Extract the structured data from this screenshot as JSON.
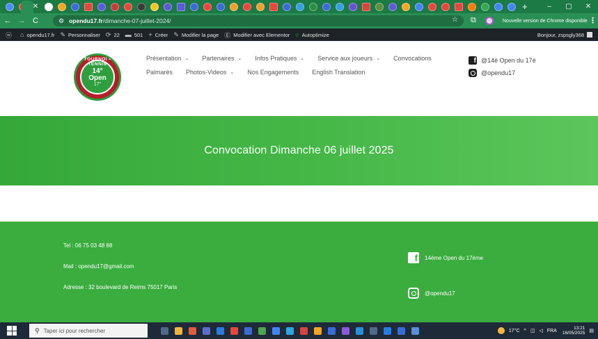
{
  "browser": {
    "tab_icon_colors": [
      "#4d8ef7",
      "#e8453c",
      "#ffffff",
      "#f5a623",
      "#3b6cd6",
      "#e8453c",
      "#5b5bd6",
      "#c93b3b",
      "#e8453c",
      "#3b3b3b",
      "#f5c623",
      "#5b5bd6",
      "#5b5bd6",
      "#3b6cd6",
      "#e8453c",
      "#3b6cd6",
      "#f29e2e",
      "#e8453c",
      "#f29e2e",
      "#e8453c",
      "#3b6cd6",
      "#34a0e0",
      "#2c8f3f",
      "#3b6cd6",
      "#34a0e0",
      "#6b4fd6",
      "#d6453c",
      "#5b8f3f",
      "#5b5bd6",
      "#f5a623",
      "#4285f4",
      "#e8453c",
      "#e8453c",
      "#e8453c",
      "#ff7a00",
      "#34a853",
      "#4285f4",
      "#4285f4"
    ],
    "new_tab": "+",
    "window_controls": [
      "–",
      "▢",
      "✕"
    ],
    "url_host": "opendu17.fr",
    "url_path": "/dimanche-07-juillet-2024/",
    "update_chip_label": "Nouvelle version de Chrome disponible",
    "menu_label": "⋮"
  },
  "adminbar": {
    "items": [
      {
        "icon": "wordpress-icon",
        "glyph": "ⓦ",
        "label": ""
      },
      {
        "icon": "home-icon",
        "glyph": "⌂",
        "label": "opendu17.fr"
      },
      {
        "icon": "brush-icon",
        "glyph": "✎",
        "label": "Personnaliser"
      },
      {
        "icon": "updates-icon",
        "glyph": "⟳",
        "label": "22"
      },
      {
        "icon": "comments-icon",
        "glyph": "▬",
        "label": "501"
      },
      {
        "icon": "plus-icon",
        "glyph": "+",
        "label": "Créer"
      },
      {
        "icon": "pencil-icon",
        "glyph": "✎",
        "label": "Modifier la page"
      },
      {
        "icon": "elementor-icon",
        "glyph": "Ⓔ",
        "label": "Modifier avec Elementor"
      },
      {
        "icon": "autoptimize-icon",
        "glyph": "○",
        "label": "Autoptimize"
      }
    ],
    "greeting": "Bonjour, zspsgly368"
  },
  "logo": {
    "ring_text": "TOURNOI • TENNIS",
    "line1": "14°",
    "line2": "Open",
    "line3": "17°"
  },
  "menu": {
    "row1": [
      {
        "label": "Présentation",
        "caret": "⌄"
      },
      {
        "label": "Partenaires",
        "caret": "⌄"
      },
      {
        "label": "Infos Pratiques",
        "caret": "⌄"
      },
      {
        "label": "Service aux joueurs",
        "caret": "⌄"
      },
      {
        "label": "Convocations",
        "caret": ""
      }
    ],
    "row2": [
      {
        "label": "Palmarès",
        "caret": ""
      },
      {
        "label": "Photos-Videos",
        "caret": "⌄"
      },
      {
        "label": "Nos Engagements",
        "caret": ""
      },
      {
        "label": "English Translation",
        "caret": ""
      }
    ]
  },
  "social_header": {
    "facebook": "@14è Open du 17è",
    "instagram": "@opendu17"
  },
  "hero": {
    "title": "Convocation Dimanche 06 juillet 2025"
  },
  "footer": {
    "tel": "Tel : 06 75 03 48 88",
    "mail": "Mail : opendu17@gmail.com",
    "address": "Adresse : 32 boulevard de Reims 75017 Paris",
    "facebook": "14ème Open du 17ème",
    "instagram": "@opendu17"
  },
  "taskbar": {
    "search_placeholder": "Taper ici pour rechercher",
    "app_colors": [
      "#4f6a8a",
      "#f2b33d",
      "#e25b3c",
      "#5b6ecf",
      "#2a7be0",
      "#e8453c",
      "#3b6cd6",
      "#4da64e",
      "#4285f4",
      "#2ca5e0",
      "#d6453c",
      "#f5a623",
      "#3b6cd6",
      "#8a5bd6",
      "#2c8fd6",
      "#4f6a8a",
      "#2a7be0",
      "#3b6cd6",
      "#5b8fd6"
    ],
    "weather": "17°C",
    "language": "FRA",
    "time": "13:21",
    "date": "16/05/2025"
  }
}
